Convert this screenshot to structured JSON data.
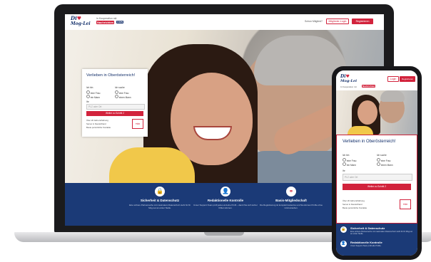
{
  "site": {
    "logo_line1": "Di",
    "logo_line2": "Mog-Lei",
    "partner_text": "In Kooperation mit",
    "partner_logo": "Nachrichten",
    "partner_logo2": "OÖN",
    "login_text": "Schon Mitglied?",
    "login_button": "Mitglieder-Login",
    "register_button": "Registrieren"
  },
  "registration": {
    "title": "Verlieben in Oberösterreich!",
    "i_am_label": "Ich bin",
    "search_label": "Ich suche",
    "options_gender": [
      "eine Frau",
      "ein Mann"
    ],
    "options_search": [
      "eine Frau",
      "einen Mann"
    ],
    "zip_label": "Ihr",
    "zip_placeholder": "PLZ oder Ort",
    "cta": "Weiter zu Schritt 2",
    "bullets": [
      "Über 20 Jahre Erfahrung",
      "Server in Deutschland",
      "Beste persönliche Kontakte"
    ],
    "seal": "TÜV"
  },
  "features": [
    {
      "icon": "lock-icon",
      "glyph": "🔒",
      "title": "Sicherheit & Datenschutz",
      "text": "Eine sichere Partnersuche mit maximalem Datenschutz steht für Di Mog-Lei an erster Stelle."
    },
    {
      "icon": "user-check-icon",
      "glyph": "👤",
      "title": "Redaktionelle Kontrolle",
      "text": "Unser Support-Team prüft jedes einzelne Profil – damit Sie sich sicher fühlen können."
    },
    {
      "icon": "hearts-icon",
      "glyph": "⚭",
      "title": "Basis-Mitgliedschaft",
      "text": "Die Registrierung ist komplett kostenlos und Sie können Profile ohne Limit ansehen."
    }
  ],
  "phone": {
    "login_button": "Login",
    "register_button": "Registrieren",
    "feature_titles": [
      "Sicherheit & Datenschutz",
      "Redaktionelle Kontrolle"
    ],
    "feature_texts": [
      "Eine sichere Partnersuche mit maximalem Datenschutz steht für Di Mog-Lei an erster Stelle.",
      "Unser Support-Team prüft alle Profile."
    ]
  },
  "colors": {
    "brand_red": "#d2233c",
    "brand_blue": "#1b3a77"
  }
}
